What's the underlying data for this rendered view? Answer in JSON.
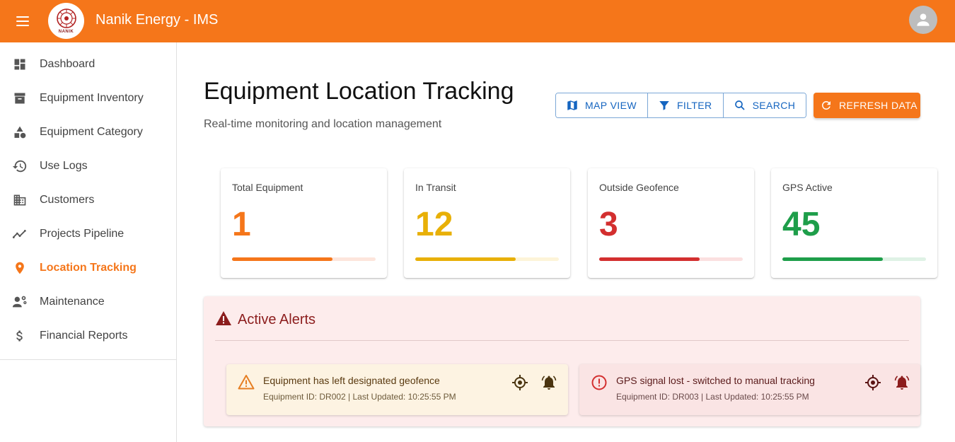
{
  "app": {
    "title": "Nanik Energy - IMS",
    "logo_text": "NANIK",
    "brand_color": "#f5761a"
  },
  "sidebar": {
    "items": [
      {
        "label": "Dashboard",
        "icon": "dashboard-icon",
        "active": false
      },
      {
        "label": "Equipment Inventory",
        "icon": "inventory-icon",
        "active": false
      },
      {
        "label": "Equipment Category",
        "icon": "category-icon",
        "active": false
      },
      {
        "label": "Use Logs",
        "icon": "history-icon",
        "active": false
      },
      {
        "label": "Customers",
        "icon": "building-icon",
        "active": false
      },
      {
        "label": "Projects Pipeline",
        "icon": "trend-icon",
        "active": false
      },
      {
        "label": "Location Tracking",
        "icon": "location-pin-icon",
        "active": true
      },
      {
        "label": "Maintenance",
        "icon": "engineering-icon",
        "active": false
      },
      {
        "label": "Financial Reports",
        "icon": "dollar-icon",
        "active": false
      }
    ]
  },
  "page": {
    "title": "Equipment Location Tracking",
    "subtitle": "Real-time monitoring and location management"
  },
  "toolbar": {
    "map_view_label": "MAP VIEW",
    "filter_label": "FILTER",
    "search_label": "SEARCH",
    "refresh_label": "REFRESH DATA"
  },
  "stats": [
    {
      "label": "Total Equipment",
      "value": "1",
      "color": "#f5761a",
      "track": "#fde5dc",
      "progress": 0.7
    },
    {
      "label": "In Transit",
      "value": "12",
      "color": "#e8b007",
      "track": "#fdf4d8",
      "progress": 0.7
    },
    {
      "label": "Outside Geofence",
      "value": "3",
      "color": "#d32f2f",
      "track": "#fbe0e0",
      "progress": 0.7
    },
    {
      "label": "GPS Active",
      "value": "45",
      "color": "#1e9e4a",
      "track": "#dff2e5",
      "progress": 0.7
    }
  ],
  "alerts": {
    "title": "Active Alerts",
    "items": [
      {
        "message": "Equipment has left designated geofence",
        "meta": "Equipment ID: DR002 | Last Updated: 10:25:55 PM",
        "severity": "warning"
      },
      {
        "message": "GPS signal lost - switched to manual tracking",
        "meta": "Equipment ID: DR003 | Last Updated: 10:25:55 PM",
        "severity": "error"
      }
    ]
  }
}
